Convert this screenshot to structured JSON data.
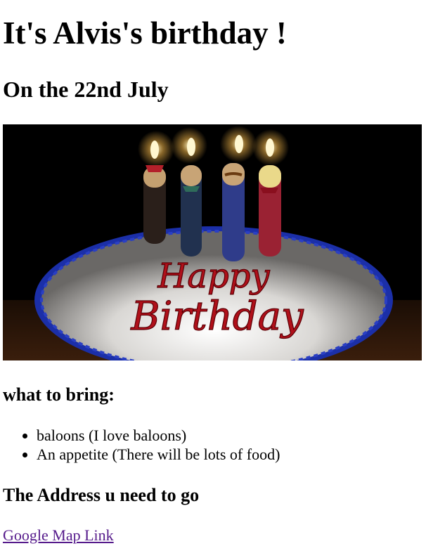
{
  "heading": "It's Alvis's birthday !",
  "date_heading": "On the 22nd July",
  "image": {
    "cake_text_line1": "Happy",
    "cake_text_line2": "Birthday"
  },
  "bring": {
    "title": "what to bring:",
    "items": [
      "baloons (I love baloons)",
      "An appetite (There will be lots of food)"
    ]
  },
  "address": {
    "title": "The Address u need to go",
    "link_label": "Google Map Link"
  },
  "colors": {
    "link_visited": "#551a8b",
    "image_background": "#000000",
    "cake_frosting_text": "#b0101a",
    "cake_border": "#1b2fa8"
  }
}
